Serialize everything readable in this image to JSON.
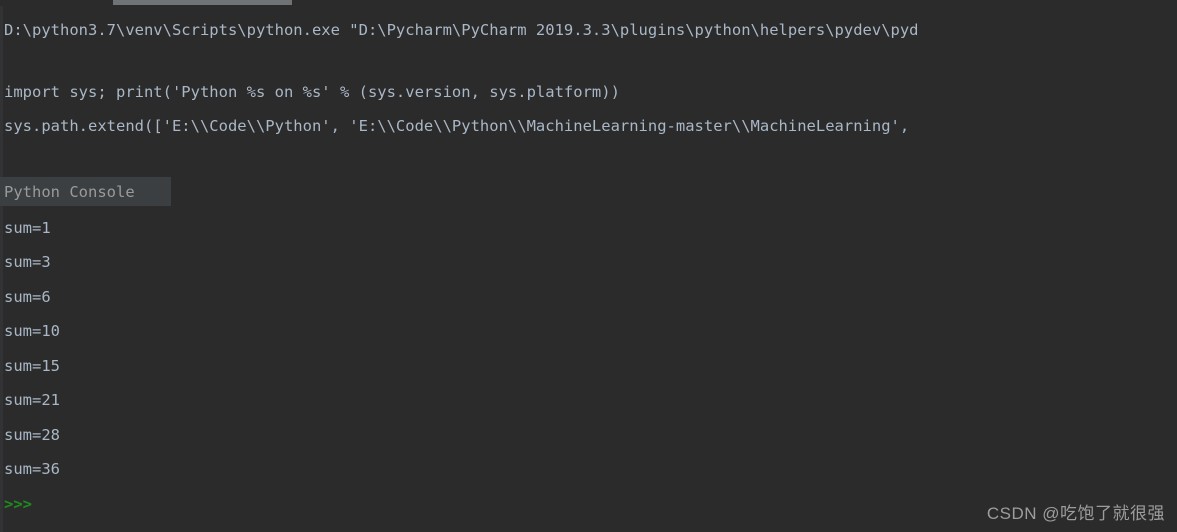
{
  "window": {
    "background_color": "#2b2b2b",
    "text_color": "#a9b7c6",
    "prompt_color": "#1f8b1f",
    "highlight_color": "#3c3f41",
    "scrollbar_thumb_color": "#6f7376"
  },
  "scrollbar": {
    "name": "horizontal-scrollbar"
  },
  "console": {
    "command_lines": [
      "D:\\python3.7\\venv\\Scripts\\python.exe \"D:\\Pycharm\\PyCharm 2019.3.3\\plugins\\python\\helpers\\pydev\\pyd",
      "import sys; print('Python %s on %s' % (sys.version, sys.platform))",
      "sys.path.extend(['E:\\\\Code\\\\Python', 'E:\\\\Code\\\\Python\\\\MachineLearning-master\\\\MachineLearning',"
    ],
    "section_label": "Python Console",
    "output_lines": [
      "sum=1",
      "sum=3",
      "sum=6",
      "sum=10",
      "sum=15",
      "sum=21",
      "sum=28",
      "sum=36"
    ],
    "prompt": ">>>"
  },
  "watermark": {
    "text": "CSDN @吃饱了就很强"
  }
}
